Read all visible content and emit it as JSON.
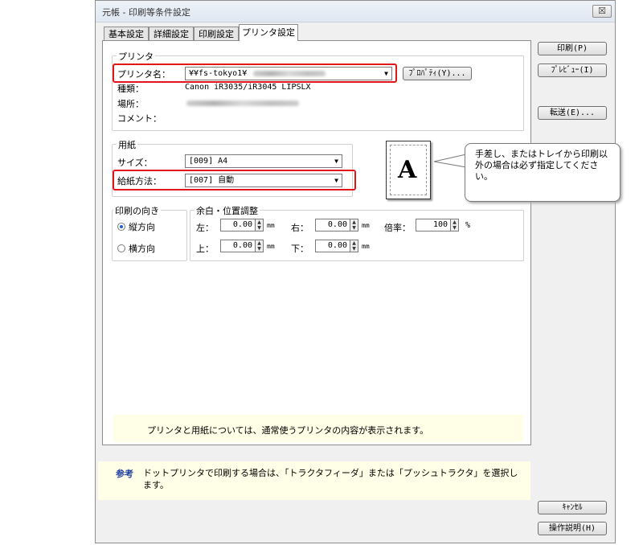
{
  "window": {
    "title": "元帳 - 印刷等条件設定",
    "close_label": "☒"
  },
  "tabs": [
    {
      "label": "基本設定"
    },
    {
      "label": "詳細設定"
    },
    {
      "label": "印刷設定"
    },
    {
      "label": "プリンタ設定"
    }
  ],
  "printer": {
    "group_label": "プリンタ",
    "name_label": "プリンタ名：",
    "name_value": "¥¥fs-tokyo1¥",
    "properties_label": "ﾌﾟﾛﾊﾟﾃｨ(Y)...",
    "type_label": "種類：",
    "type_value": "Canon iR3035/iR3045 LIPSLX",
    "location_label": "場所：",
    "comment_label": "コメント："
  },
  "paper": {
    "group_label": "用紙",
    "size_label": "サイズ：",
    "size_value": "[009] A4",
    "source_label": "給紙方法：",
    "source_value": "[007] 自動",
    "preview_letter": "A"
  },
  "callout_text": "手差し、またはトレイから印刷以外の場合は必ず指定してください。",
  "orientation": {
    "group_label": "印刷の向き",
    "portrait_label": "縦方向",
    "landscape_label": "横方向",
    "selected": "portrait"
  },
  "margins": {
    "group_label": "余白・位置調整",
    "left_label": "左：",
    "left_value": "0.00",
    "right_label": "右：",
    "right_value": "0.00",
    "top_label": "上：",
    "top_value": "0.00",
    "bottom_label": "下：",
    "bottom_value": "0.00",
    "unit": "mm",
    "scale_label": "倍率：",
    "scale_value": "100",
    "scale_unit": "%"
  },
  "note_text": "プリンタと用紙については、通常使うプリンタの内容が表示されます。",
  "reference": {
    "label": "参考",
    "text": "ドットプリンタで印刷する場合は、「トラクタフィーダ」または「プッシュトラクタ」を選択します。"
  },
  "buttons": {
    "print": "印刷(P)",
    "preview": "ﾌﾟﾚﾋﾞｭｰ(I)",
    "transfer": "転送(E)...",
    "cancel": "ｷｬﾝｾﾙ",
    "help": "操作説明(H)"
  },
  "colors": {
    "highlight_border": "#e0161b",
    "note_bg": "#fffee6",
    "radio_dot": "#1f5fd1"
  }
}
